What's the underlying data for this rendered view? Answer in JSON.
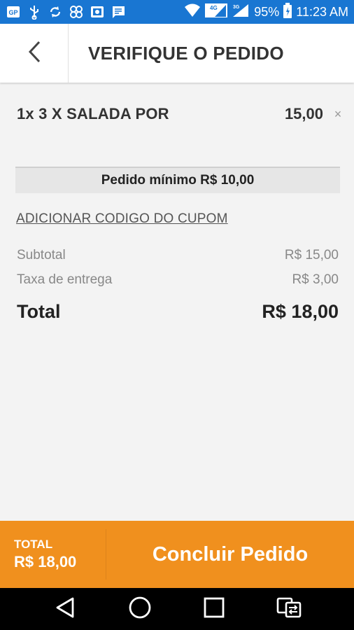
{
  "status_bar": {
    "battery": "95%",
    "time": "11:23 AM",
    "network_label": "4G",
    "network_label2": "3G"
  },
  "header": {
    "title": "VERIFIQUE O PEDIDO"
  },
  "order": {
    "items": [
      {
        "name": "1x 3 X SALADA POR",
        "price": "15,00",
        "remove": "×"
      }
    ],
    "minimum": "Pedido mínimo R$ 10,00",
    "coupon_link": "ADICIONAR CODIGO DO CUPOM"
  },
  "summary": {
    "subtotal_label": "Subtotal",
    "subtotal_value": "R$ 15,00",
    "delivery_label": "Taxa de entrega",
    "delivery_value": "R$ 3,00",
    "total_label": "Total",
    "total_value": "R$ 18,00"
  },
  "action_bar": {
    "total_label": "TOTAL",
    "total_amount": "R$ 18,00",
    "button_label": "Concluir Pedido"
  },
  "colors": {
    "status_bar": "#1976d2",
    "accent": "#f0901e",
    "background": "#f3f3f3"
  }
}
